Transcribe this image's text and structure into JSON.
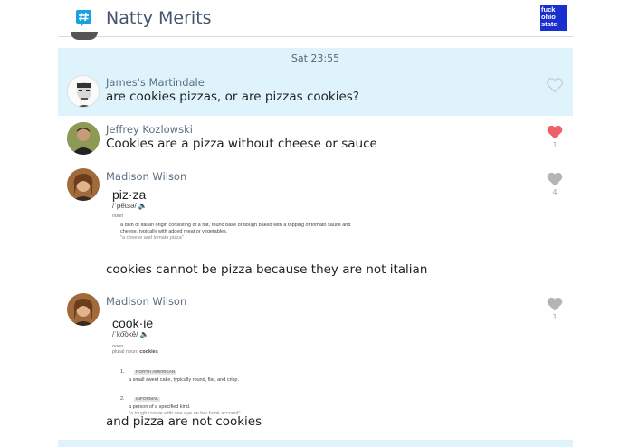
{
  "header": {
    "app_icon": "chat-hash-icon",
    "title": "Natty Merits",
    "group_avatar_text": "fuck ohio state"
  },
  "date_banner": {
    "label": "Sat 23:55"
  },
  "messages": [
    {
      "author": "James's Martindale",
      "text": "are cookies pizzas, or are pizzas cookies?",
      "like_icon": "heart-outline-icon",
      "likes": ""
    },
    {
      "author": "Jeffrey Kozlowski",
      "text": "Cookies are a pizza without cheese or sauce",
      "like_icon": "heart-filled-icon",
      "like_color": "#f0606a",
      "likes": "1"
    },
    {
      "author": "Madison Wilson",
      "text": "cookies cannot be pizza because they are not italian",
      "like_icon": "heart-filled-icon",
      "like_color": "#b5b5b5",
      "likes": "4",
      "dictionary": {
        "word": "piz·za",
        "pronunciation": "/ˈpētsə/ 🔈",
        "part_of_speech": "noun",
        "definition": "a dish of Italian origin consisting of a flat, round base of dough baked with a topping of tomato sauce and cheese, typically with added meat or vegetables.",
        "example": "\"a cheese and tomato pizza\""
      }
    },
    {
      "author": "Madison Wilson",
      "text": "and pizza are not cookies",
      "like_icon": "heart-filled-icon",
      "like_color": "#b5b5b5",
      "likes": "1",
      "dictionary": {
        "word": "cook·ie",
        "pronunciation": "/ˈko͝okē/ 🔈",
        "part_of_speech": "noun",
        "plural_label": "plural noun:",
        "plural": "cookies",
        "senses": [
          {
            "num": "1.",
            "tag": "NORTH AMERICAN",
            "definition": "a small sweet cake, typically round, flat, and crisp.",
            "example": ""
          },
          {
            "num": "2.",
            "tag": "INFORMAL",
            "definition": "a person of a specified kind.",
            "example": "\"a tough cookie with one eye on her bank account\""
          }
        ]
      }
    }
  ]
}
